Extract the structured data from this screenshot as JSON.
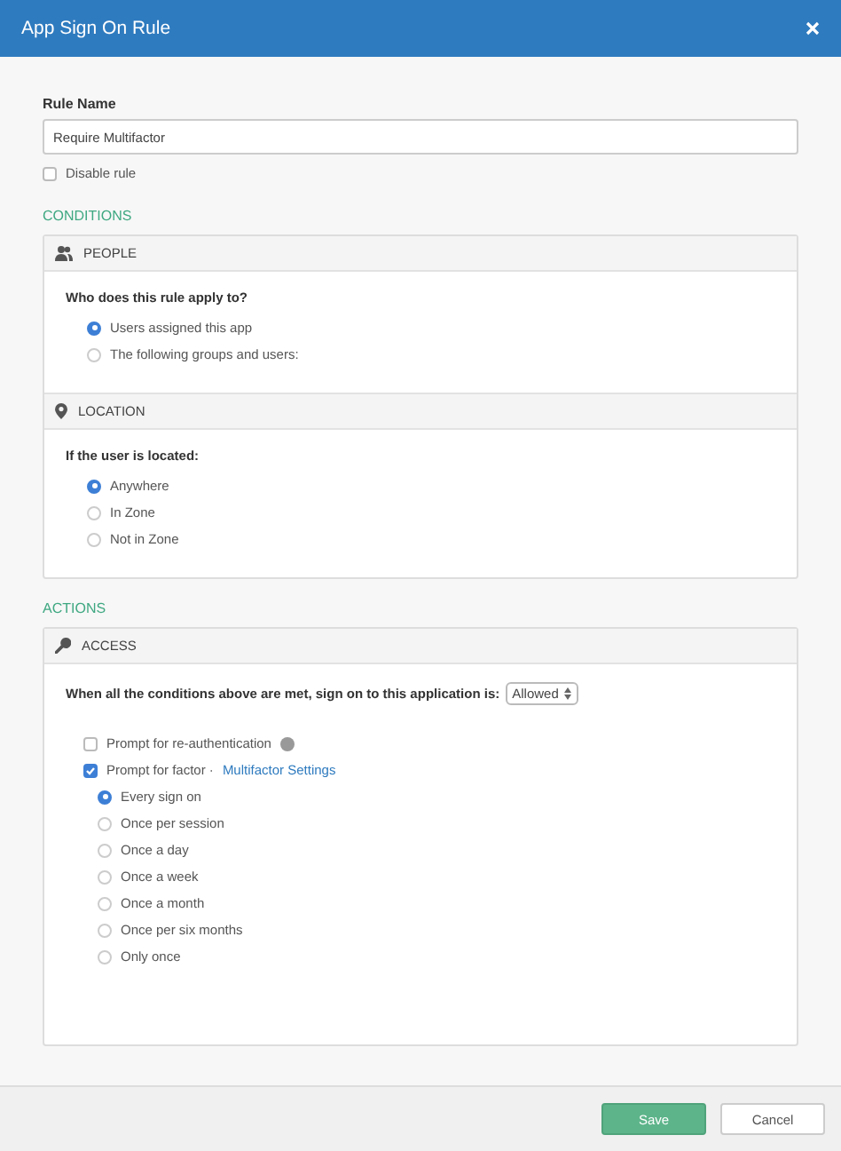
{
  "window": {
    "title": "App Sign On Rule"
  },
  "rule_name": {
    "label": "Rule Name",
    "value": "Require Multifactor"
  },
  "disable_rule": {
    "label": "Disable rule",
    "checked": false
  },
  "conditions": {
    "heading": "CONDITIONS",
    "panels": [
      {
        "kind": "people",
        "title": "PEOPLE",
        "question": "Who does this rule apply to?",
        "options": [
          {
            "label": "Users assigned this app",
            "selected": true
          },
          {
            "label": "The following groups and users:",
            "selected": false
          }
        ]
      },
      {
        "kind": "location",
        "title": "LOCATION",
        "question": "If the user is located:",
        "options": [
          {
            "label": "Anywhere",
            "selected": true
          },
          {
            "label": "In Zone",
            "selected": false
          },
          {
            "label": "Not in Zone",
            "selected": false
          }
        ]
      }
    ]
  },
  "actions": {
    "heading": "ACTIONS",
    "panel": {
      "kind": "access",
      "title": "ACCESS",
      "sentence": "When all the conditions above are met, sign on to this application is:",
      "select_value": "Allowed",
      "reauth": {
        "label": "Prompt for re-authentication",
        "checked": false
      },
      "factor": {
        "label": "Prompt for factor ·",
        "link": "Multifactor Settings",
        "checked": true,
        "frequencies": [
          {
            "label": "Every sign on",
            "selected": true
          },
          {
            "label": "Once per session",
            "selected": false
          },
          {
            "label": "Once a day",
            "selected": false
          },
          {
            "label": "Once a week",
            "selected": false
          },
          {
            "label": "Once a month",
            "selected": false
          },
          {
            "label": "Once per six months",
            "selected": false
          },
          {
            "label": "Only once",
            "selected": false
          }
        ]
      }
    }
  },
  "buttons": [
    {
      "label": "Save",
      "kind": "primary"
    },
    {
      "label": "Cancel",
      "kind": "secondary"
    }
  ]
}
